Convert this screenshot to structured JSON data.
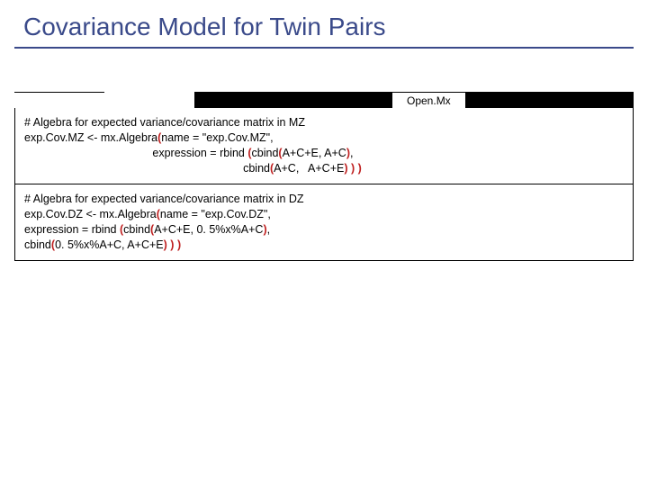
{
  "title": "Covariance Model for Twin Pairs",
  "tab_label": "Open.Mx",
  "mz": {
    "comment": "# Algebra for expected variance/covariance matrix in MZ",
    "line1_a": "exp.Cov.MZ <- mx.Algebra",
    "line1_b": "name = \"exp.Cov.MZ\",",
    "line2_a": "                                         expression = rbind ",
    "line2_b": "cbind",
    "line2_c": "A+C+E, A+C",
    "line2_d": ",",
    "line3_a": "                                                                      cbind",
    "line3_b": "A+C,   A+C+E",
    "line3_c": " ",
    "line3_d": " ",
    "line3_e": ""
  },
  "dz": {
    "comment": "# Algebra for expected variance/covariance matrix in DZ",
    "line1_a": "exp.Cov.DZ <- mx.Algebra",
    "line1_b": "name = \"exp.Cov.DZ\",",
    "line2_a": "                                         expression = rbind ",
    "line2_b": "cbind",
    "line2_c": "A+C+E,      0. 5%x%A+C",
    "line2_d": ",",
    "line3_a": "                                                                      cbind",
    "line3_b": "0. 5%x%A+C, A+C+E",
    "line3_c": " ",
    "line3_d": " ",
    "line3_e": ""
  }
}
